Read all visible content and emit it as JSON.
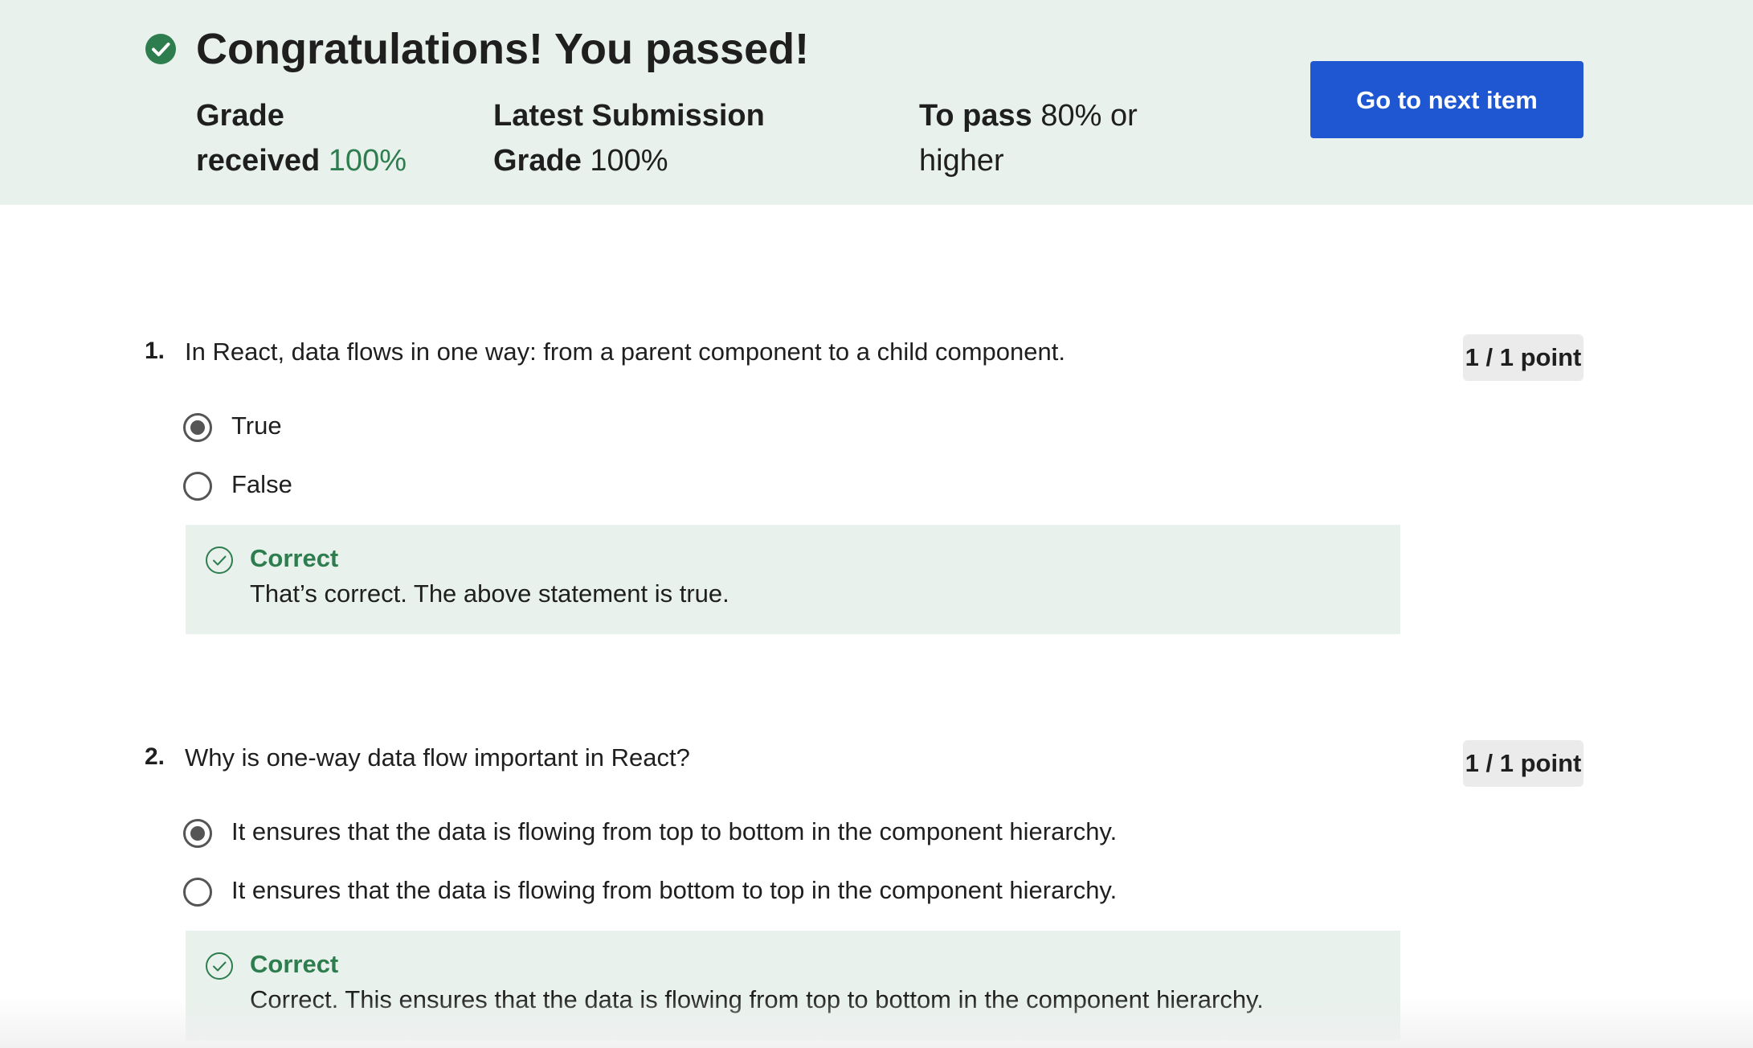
{
  "banner": {
    "title": "Congratulations! You passed!",
    "grade_label_1": "Grade",
    "grade_label_2": "received",
    "grade_value": "100%",
    "latest_label_1": "Latest Submission",
    "latest_label_2": "Grade",
    "latest_value": "100%",
    "topass_label": "To pass",
    "topass_value_1": "80% or",
    "topass_value_2": "higher",
    "next_button": "Go to next item"
  },
  "questions": [
    {
      "number": "1.",
      "text": "In React, data flows in one way: from a parent component to a child component.",
      "points": "1 / 1 point",
      "options": [
        {
          "label": "True",
          "selected": true
        },
        {
          "label": "False",
          "selected": false
        }
      ],
      "feedback": {
        "title": "Correct",
        "text": "That’s correct. The above statement is true."
      }
    },
    {
      "number": "2.",
      "text": "Why is one-way data flow important in React?",
      "points": "1 / 1 point",
      "options": [
        {
          "label": "It ensures that the data is flowing from top to bottom in the component hierarchy.",
          "selected": true
        },
        {
          "label": "It ensures that the data is flowing from bottom to top in the component hierarchy.",
          "selected": false
        }
      ],
      "feedback": {
        "title": "Correct",
        "text": "Correct. This ensures that the data is flowing from top to bottom in the component hierarchy."
      }
    }
  ],
  "colors": {
    "banner_bg": "#e8f1ec",
    "success_green": "#2e7d4f",
    "primary_button": "#1f56d1"
  },
  "icons": {
    "pass": "check-circle-filled-icon",
    "feedback": "check-circle-outline-icon"
  }
}
